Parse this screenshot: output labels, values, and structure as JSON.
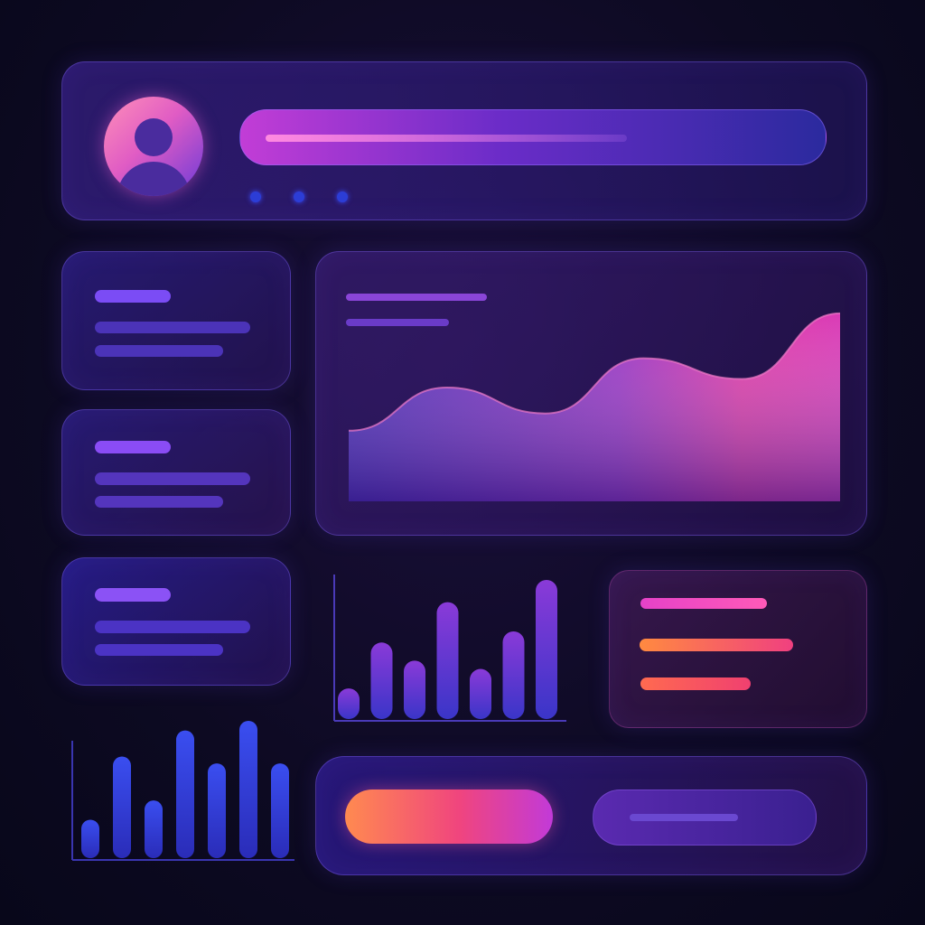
{
  "header": {
    "avatar_icon": "user-icon",
    "search_placeholder": "",
    "pagination_dots": 3
  },
  "stat_cards": [
    {
      "name": "stat-card-1"
    },
    {
      "name": "stat-card-2"
    },
    {
      "name": "stat-card-3"
    }
  ],
  "colors": {
    "accent_pink": "#e63fb0",
    "accent_purple": "#7a3cf0",
    "accent_blue": "#2f3fe0",
    "accent_orange": "#ff7a45"
  },
  "chart_data": [
    {
      "type": "area",
      "series": [
        {
          "values": [
            0.2,
            0.45,
            0.3,
            0.62,
            0.5,
            0.88
          ]
        }
      ]
    },
    {
      "type": "bar",
      "values": [
        0.22,
        0.55,
        0.42,
        0.84,
        0.36,
        0.63,
        1.0
      ]
    },
    {
      "type": "bar",
      "values": [
        0.28,
        0.74,
        0.42,
        0.93,
        0.69,
        1.0,
        0.69
      ]
    }
  ]
}
